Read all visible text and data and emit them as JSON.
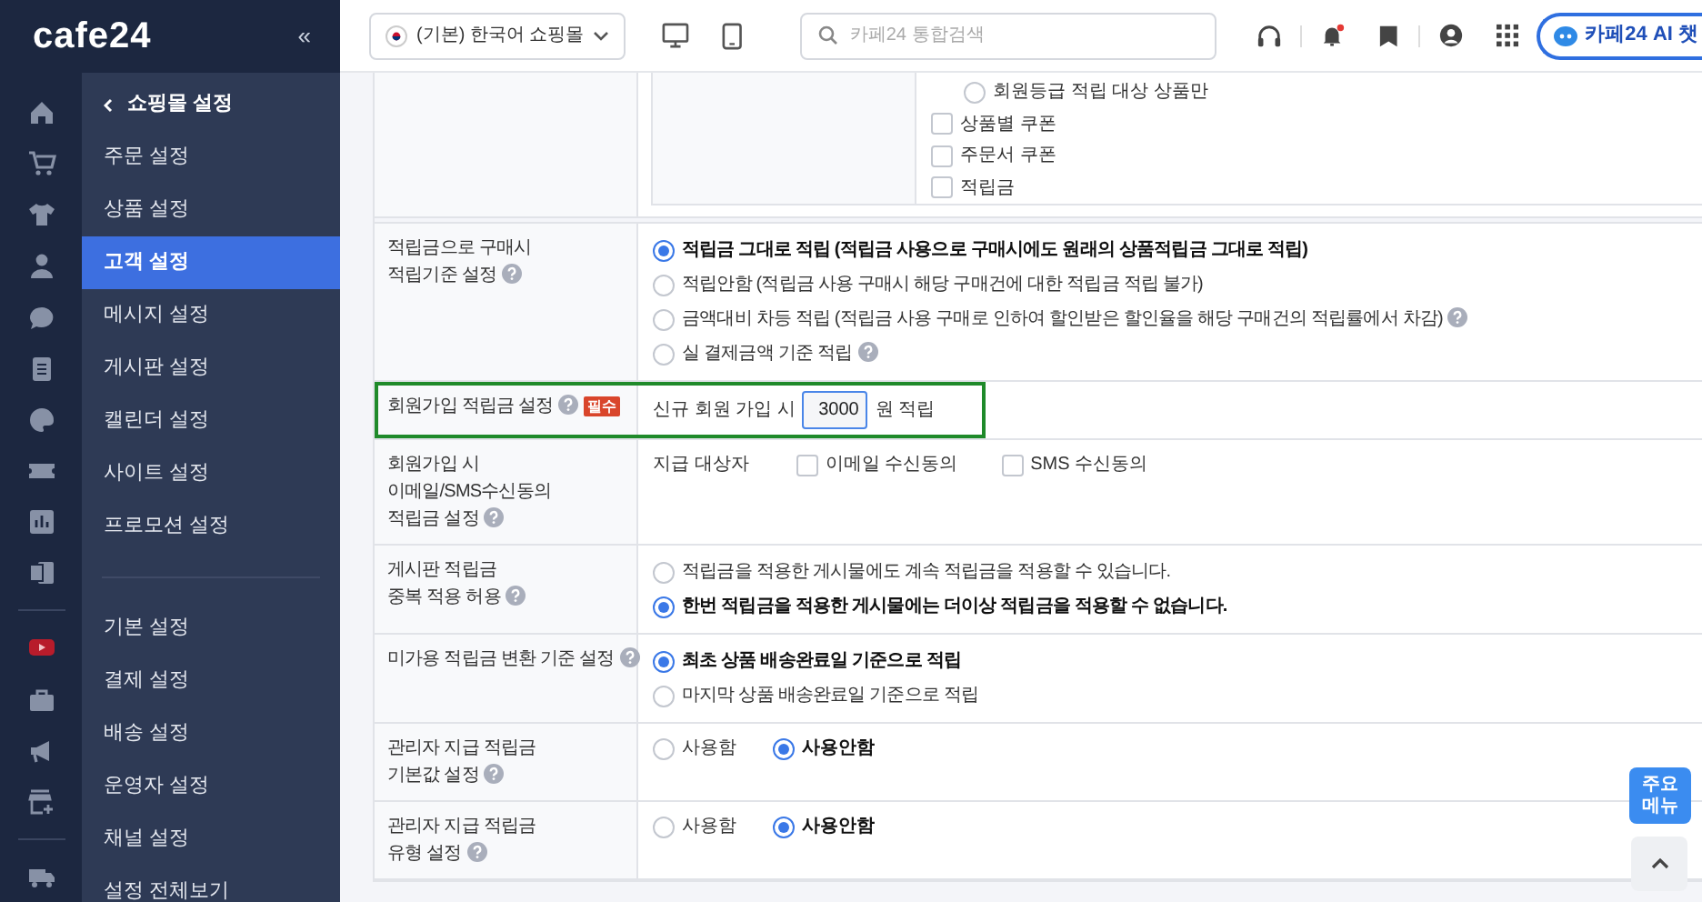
{
  "sidebar": {
    "logo": "cafe24",
    "collapse": "«",
    "back": "쇼핑몰 설정",
    "groups": [
      [
        {
          "label": "주문 설정",
          "selected": false
        },
        {
          "label": "상품 설정",
          "selected": false
        },
        {
          "label": "고객 설정",
          "selected": true
        },
        {
          "label": "메시지 설정",
          "selected": false
        },
        {
          "label": "게시판 설정",
          "selected": false
        },
        {
          "label": "캘린더 설정",
          "selected": false
        },
        {
          "label": "사이트 설정",
          "selected": false
        },
        {
          "label": "프로모션 설정",
          "selected": false
        }
      ],
      [
        {
          "label": "기본 설정",
          "selected": false
        },
        {
          "label": "결제 설정",
          "selected": false
        },
        {
          "label": "배송 설정",
          "selected": false
        },
        {
          "label": "운영자 설정",
          "selected": false
        },
        {
          "label": "채널 설정",
          "selected": false
        },
        {
          "label": "설정 전체보기",
          "selected": false
        }
      ]
    ]
  },
  "topbar": {
    "shop_select": "(기본) 한국어 쇼핑몰",
    "search": {
      "placeholder": "카페24 통합검색"
    },
    "ai_button": "카페24 AI 챗"
  },
  "top_options": [
    {
      "kind": "radio",
      "label": "회원등급 적립 대상 상품만",
      "selected": false
    },
    {
      "kind": "checkbox",
      "label": "상품별 쿠폰",
      "checked": false
    },
    {
      "kind": "checkbox",
      "label": "주문서 쿠폰",
      "checked": false
    },
    {
      "kind": "checkbox",
      "label": "적립금",
      "checked": false
    }
  ],
  "rows": [
    {
      "label": "적립금으로 구매시\n적립기준 설정",
      "kind": "radio_list",
      "highlighted": false,
      "options": [
        {
          "label": "적립금 그대로 적립 (적립금 사용으로 구매시에도 원래의 상품적립금 그대로 적립)",
          "selected": true,
          "help": false
        },
        {
          "label": "적립안함 (적립금 사용 구매시 해당 구매건에 대한 적립금 적립 불가)",
          "selected": false,
          "help": false
        },
        {
          "label": "금액대비 차등 적립 (적립금 사용 구매로 인하여 할인받은 할인율을 해당 구매건의 적립률에서 차감)",
          "selected": false,
          "help": true
        },
        {
          "label": "실 결제금액 기준 적립",
          "selected": false,
          "help": true
        }
      ]
    },
    {
      "label": "회원가입 적립금 설정",
      "badge": "필수",
      "kind": "amount",
      "highlighted": true,
      "prefix": "신규 회원 가입 시",
      "value": "3000",
      "suffix": "원 적립"
    },
    {
      "label": "회원가입 시\n이메일/SMS수신동의\n적립금 설정",
      "kind": "checkboxes",
      "highlighted": false,
      "caption": "지급 대상자",
      "options": [
        {
          "label": "이메일 수신동의",
          "checked": false
        },
        {
          "label": "SMS 수신동의",
          "checked": false
        }
      ]
    },
    {
      "label": "게시판 적립금\n중복 적용 허용",
      "kind": "radio_list",
      "highlighted": false,
      "options": [
        {
          "label": "적립금을 적용한 게시물에도 계속 적립금을 적용할 수 있습니다.",
          "selected": false,
          "help": false
        },
        {
          "label": "한번 적립금을 적용한 게시물에는 더이상 적립금을 적용할 수 없습니다.",
          "selected": true,
          "help": false
        }
      ]
    },
    {
      "label": "미가용 적립금 변환 기준 설정",
      "kind": "radio_list",
      "highlighted": false,
      "options": [
        {
          "label": "최초 상품 배송완료일 기준으로 적립",
          "selected": true,
          "help": false
        },
        {
          "label": "마지막 상품 배송완료일 기준으로 적립",
          "selected": false,
          "help": false
        }
      ]
    },
    {
      "label": "관리자 지급 적립금\n기본값 설정",
      "kind": "radio_inline",
      "highlighted": false,
      "options": [
        {
          "label": "사용함",
          "selected": false
        },
        {
          "label": "사용안함",
          "selected": true
        }
      ]
    },
    {
      "label": "관리자 지급 적립금\n유형 설정",
      "kind": "radio_inline",
      "highlighted": false,
      "options": [
        {
          "label": "사용함",
          "selected": false
        },
        {
          "label": "사용안함",
          "selected": true
        }
      ]
    }
  ],
  "floating": {
    "main_menu": "주요\n메뉴"
  }
}
